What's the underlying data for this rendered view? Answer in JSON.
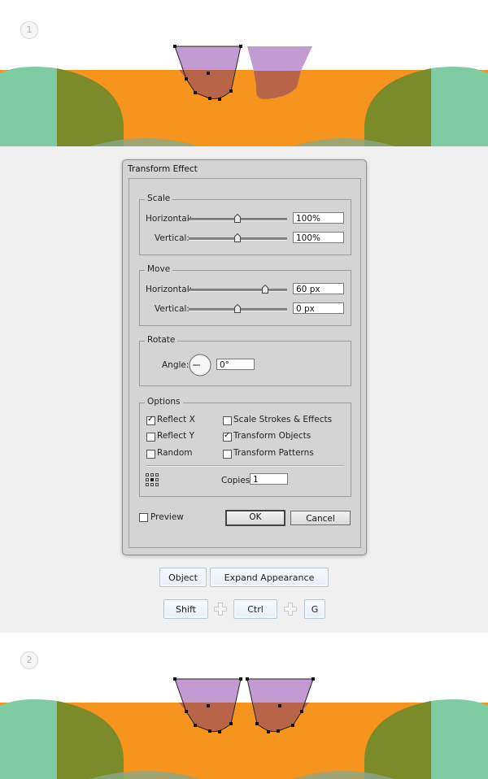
{
  "steps": {
    "first": "1",
    "second": "2"
  },
  "dialog": {
    "title": "Transform Effect",
    "scale": {
      "legend": "Scale",
      "horizontal_label": "Horizontal:",
      "horizontal_value": "100%",
      "vertical_label": "Vertical:",
      "vertical_value": "100%"
    },
    "move": {
      "legend": "Move",
      "horizontal_label": "Horizontal:",
      "horizontal_value": "60 px",
      "vertical_label": "Vertical:",
      "vertical_value": "0 px"
    },
    "rotate": {
      "legend": "Rotate",
      "angle_label": "Angle:",
      "angle_value": "0°"
    },
    "options": {
      "legend": "Options",
      "reflect_x": "Reflect X",
      "reflect_x_checked": true,
      "reflect_y": "Reflect Y",
      "reflect_y_checked": false,
      "random": "Random",
      "random_checked": false,
      "scale_strokes": "Scale Strokes & Effects",
      "scale_strokes_checked": false,
      "transform_objects": "Transform Objects",
      "transform_objects_checked": true,
      "transform_patterns": "Transform Patterns",
      "transform_patterns_checked": false,
      "copies_label": "Copies",
      "copies_value": "1"
    },
    "preview_label": "Preview",
    "preview_checked": false,
    "ok_label": "OK",
    "cancel_label": "Cancel"
  },
  "menu_path": {
    "object": "Object",
    "expand_appearance": "Expand Appearance"
  },
  "shortcut": {
    "shift": "Shift",
    "ctrl": "Ctrl",
    "g": "G"
  },
  "colors": {
    "orange": "#f7941d",
    "green": "#7fcba2",
    "olive": "#7b8b2a",
    "purple": "#c39bd3",
    "brown": "#b86448"
  }
}
